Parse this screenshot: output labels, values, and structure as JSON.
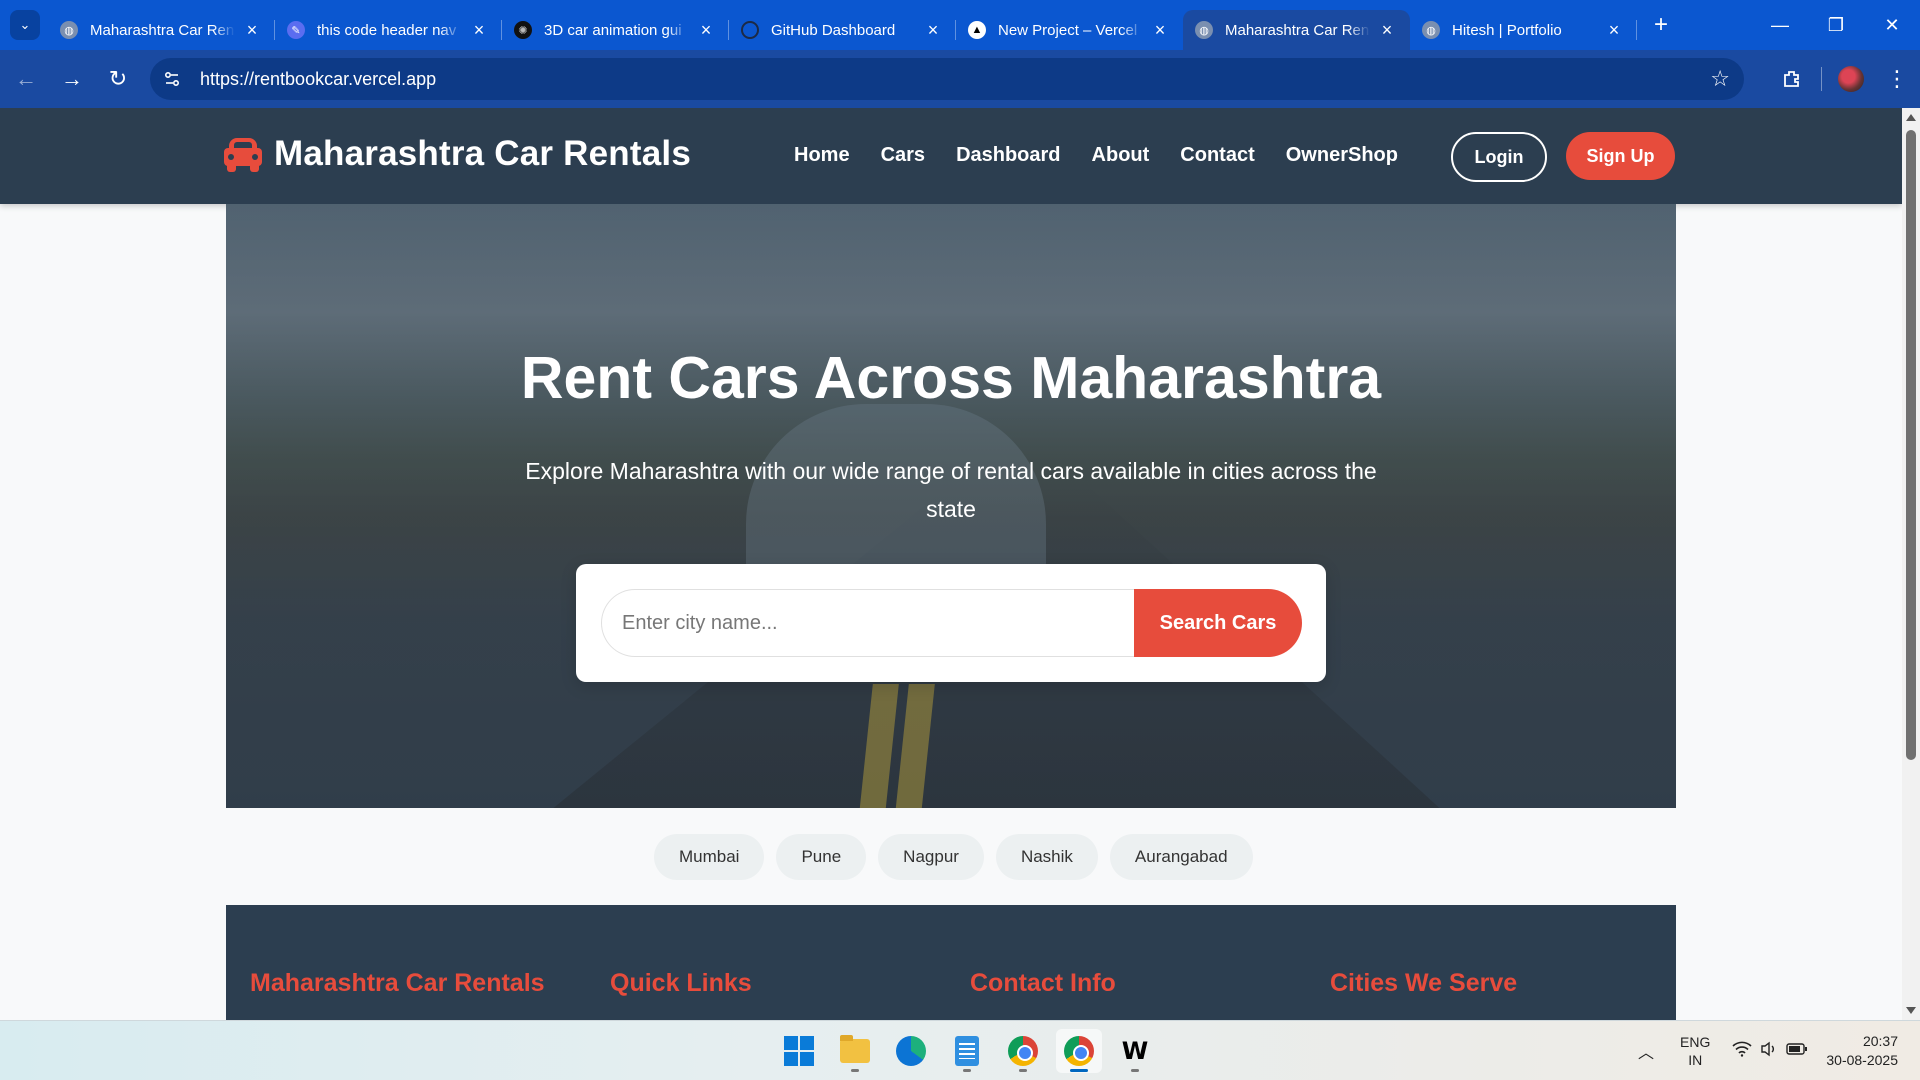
{
  "browser": {
    "tabs": [
      {
        "title": "Maharashtra Car Ren",
        "favicon": "globe-icon",
        "active": false
      },
      {
        "title": "this code header nav",
        "favicon": "ai-chat-icon",
        "active": false
      },
      {
        "title": "3D car animation gui",
        "favicon": "openai-icon",
        "active": false
      },
      {
        "title": "GitHub Dashboard",
        "favicon": "github-icon",
        "active": false
      },
      {
        "title": "New Project – Vercel",
        "favicon": "vercel-icon",
        "active": false
      },
      {
        "title": "Maharashtra Car Ren",
        "favicon": "globe-icon",
        "active": true
      },
      {
        "title": "Hitesh | Portfolio",
        "favicon": "globe-icon",
        "active": false
      }
    ],
    "url": "https://rentbookcar.vercel.app"
  },
  "site": {
    "brand": "Maharashtra Car Rentals",
    "nav": [
      "Home",
      "Cars",
      "Dashboard",
      "About",
      "Contact",
      "OwnerShop"
    ],
    "login_label": "Login",
    "signup_label": "Sign Up"
  },
  "hero": {
    "title": "Rent Cars Across Maharashtra",
    "subtitle": "Explore Maharashtra with our wide range of rental cars available in cities across the state",
    "search_placeholder": "Enter city name...",
    "search_button": "Search Cars"
  },
  "cities": [
    "Mumbai",
    "Pune",
    "Nagpur",
    "Nashik",
    "Aurangabad"
  ],
  "footer": {
    "columns": [
      "Maharashtra Car Rentals",
      "Quick Links",
      "Contact Info",
      "Cities We Serve"
    ]
  },
  "taskbar": {
    "lang_primary": "ENG",
    "lang_secondary": "IN",
    "time": "20:37",
    "date": "30-08-2025"
  },
  "colors": {
    "accent": "#e74c3c",
    "header_bg": "#2c3e50",
    "chrome_blue": "#0b57d0"
  }
}
